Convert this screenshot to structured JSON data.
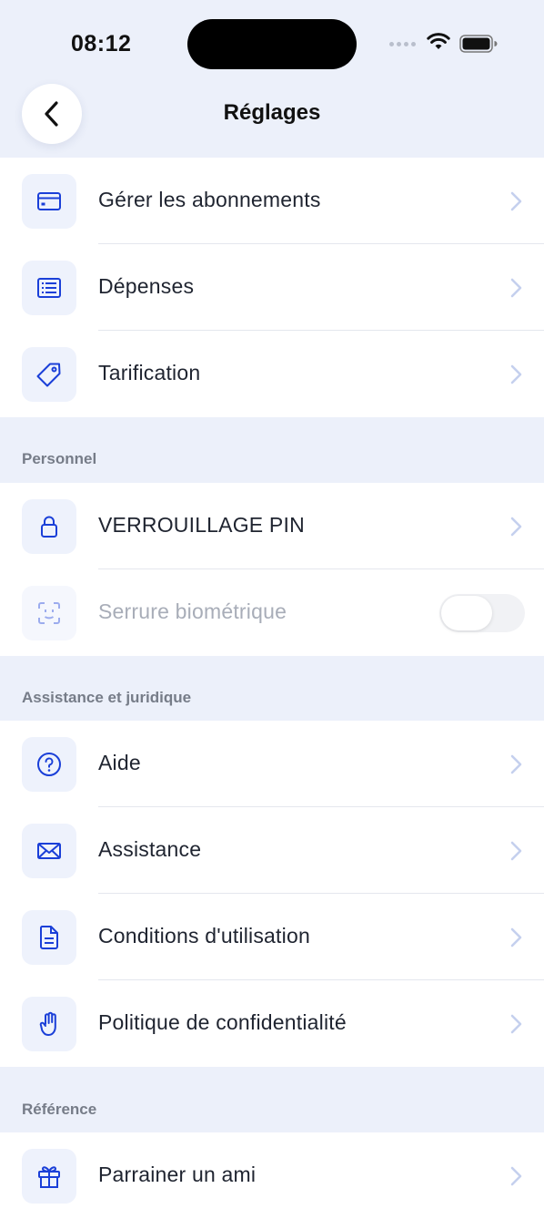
{
  "status_bar": {
    "time": "08:12"
  },
  "header": {
    "title": "Réglages"
  },
  "groups": [
    {
      "items": [
        {
          "label": "Gérer les abonnements",
          "icon": "credit-card-icon"
        },
        {
          "label": "Dépenses",
          "icon": "receipt-list-icon"
        },
        {
          "label": "Tarification",
          "icon": "price-tag-icon"
        }
      ]
    },
    {
      "section": "Personnel",
      "items": [
        {
          "label": "VERROUILLAGE PIN",
          "icon": "lock-icon"
        },
        {
          "label": "Serrure biométrique",
          "icon": "face-id-icon",
          "toggle": false,
          "disabled": true
        }
      ]
    },
    {
      "section": "Assistance et juridique",
      "items": [
        {
          "label": "Aide",
          "icon": "help-circle-icon"
        },
        {
          "label": "Assistance",
          "icon": "envelope-icon"
        },
        {
          "label": "Conditions d'utilisation",
          "icon": "document-icon"
        },
        {
          "label": "Politique de confidentialité",
          "icon": "hand-icon"
        }
      ]
    },
    {
      "section": "Référence",
      "items": [
        {
          "label": "Parrainer un ami",
          "icon": "gift-icon"
        }
      ]
    }
  ],
  "colors": {
    "background": "#ECF0FA",
    "accent": "#1A3FD8",
    "icon_bg": "#EEF2FC",
    "chevron": "#C5D0EE"
  }
}
